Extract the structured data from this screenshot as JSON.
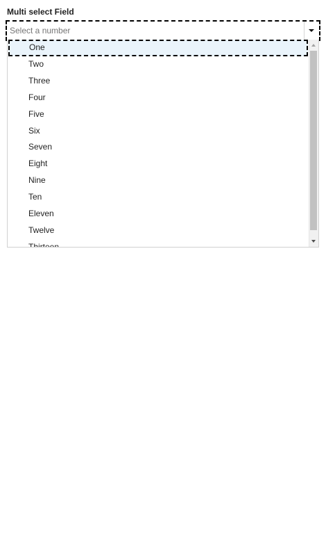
{
  "field": {
    "label": "Multi select Field",
    "placeholder": "Select a number",
    "value": ""
  },
  "listbox": {
    "options": [
      "One",
      "Two",
      "Three",
      "Four",
      "Five",
      "Six",
      "Seven",
      "Eight",
      "Nine",
      "Ten",
      "Eleven",
      "Twelve",
      "Thirteen"
    ],
    "active_option": "One"
  },
  "icons": {
    "toggle": "chevron-down-icon",
    "scroll_up": "scroll-up-arrow-icon",
    "scroll_down": "scroll-down-arrow-icon"
  },
  "colors": {
    "active_option_bg": "#eaf4fb",
    "focus_outline": "#000000",
    "scroll_thumb": "#c1c1c1"
  }
}
